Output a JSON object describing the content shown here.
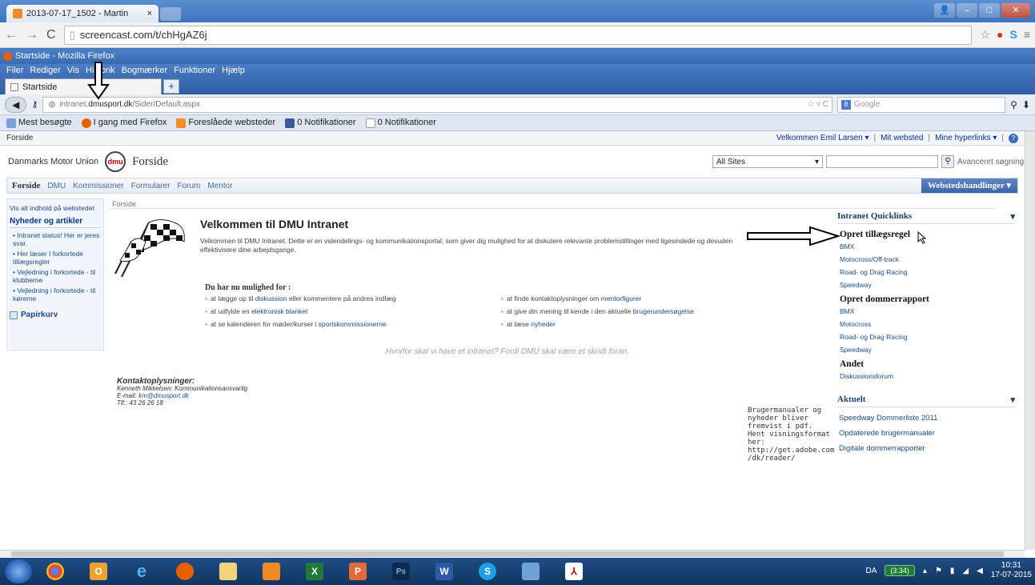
{
  "chrome": {
    "tab_title": "2013-07-17_1502 - Martin",
    "tab_close": "×",
    "url": "screencast.com/t/chHgAZ6j"
  },
  "firefox": {
    "window_title": "Startside - Mozilla Firefox",
    "menu": [
      "Filer",
      "Rediger",
      "Vis",
      "Historik",
      "Bogmærker",
      "Funktioner",
      "Hjælp"
    ],
    "tab_label": "Startside",
    "new_tab": "+",
    "url_prefix": "intranet.",
    "url_domain": "dmusport.dk",
    "url_path": "/Sider/Default.aspx",
    "search_placeholder": "Google",
    "bookmarks": [
      "Mest besøgte",
      "I gang med Firefox",
      "Foreslåede websteder",
      "0 Notifikationer",
      "0 Notifikationer"
    ]
  },
  "sp": {
    "top_left": "Forside",
    "welcome_items": [
      "Velkommen Emil Larsen ▾",
      "|",
      "Mit websted",
      "|",
      "Mine hyperlinks ▾",
      "|"
    ],
    "org_name": "Danmarks Motor Union",
    "logo_text": "dmu",
    "site_title": "Forside",
    "search_scope": "All Sites",
    "advanced_search": "Avanceret søgning",
    "nav": [
      "Forside",
      "DMU",
      "Kommissioner",
      "Formularer",
      "Forum",
      "Mentor"
    ],
    "site_actions": "Webstedshandlinger ▾",
    "left": {
      "view_all": "Vis alt indhold på webstedet",
      "news_header": "Nyheder og artikler",
      "news": [
        "• Intranet status! Her er jeres svar.",
        "• Her læser I forkortede tillægsregler",
        "• Vejledning i forkortede - til klubberne",
        "• Vejledning i forkortede - til kørerne"
      ],
      "recycle": "Papirkurv"
    },
    "breadcrumb": "Forside",
    "welcome_title": "Velkommen til DMU Intranet",
    "intro": "Velkommen til DMU Intranet. Dette er en videndelings- og kommunikationsportal, som giver dig mulighed for at diskutere relevante problemstillinger med ligesindede og desuden effektivisere dine arbejdsgange.",
    "opp_title": "Du har nu mulighed for :",
    "opps": [
      {
        "pre": "at lægge op til ",
        "link": "diskussion",
        "post": " eller kommentere på andres indlæg"
      },
      {
        "pre": "at finde kontaktoplysninger om ",
        "link": "mentorfigurer",
        "post": ""
      },
      {
        "pre": "at udfylde en ",
        "link": "elektronisk blanket",
        "post": ""
      },
      {
        "pre": "at give din mening til kende i den aktuelle ",
        "link": "brugerundersøgelse",
        "post": ""
      },
      {
        "pre": "at se kalenderen for møder/kurser i ",
        "link": "sportskommissionerne",
        "post": ""
      },
      {
        "pre": "at læse ",
        "link": "nyheder",
        "post": ""
      }
    ],
    "tagline": "Hvorfor skal vi have et intranet? Fordi DMU skal være et skridt foran.",
    "contact": {
      "title": "Kontaktoplysninger:",
      "line1": "Kenneth Mikkelsen: Kommunikationsansvarlig",
      "email_label": "E-mail: ",
      "email": "km@dmusport.dk",
      "phone": "Tlf.: 43 26 26 18"
    },
    "pdf_note": "Brugermanualer og nyheder bliver fremvist i pdf. Hent visningsformat her: http://get.adobe.com /dk/reader/",
    "quicklinks": {
      "title": "Intranet Quicklinks",
      "sec1": "Opret tillægsregel",
      "sec1_links": [
        "BMX",
        "Motocross/Off-track",
        "Road- og Drag Racing",
        "Speedway"
      ],
      "sec2": "Opret dommerrapport",
      "sec2_links": [
        "BMX",
        "Motocross",
        "Road- og Drag Racing",
        "Speedway"
      ],
      "sec3": "Andet",
      "sec3_links": [
        "Diskussionsforum"
      ]
    },
    "aktuelt": {
      "title": "Aktuelt",
      "links": [
        "Speedway Dommerliste 2011",
        "Opdaterede brugermanualer",
        "Digitale dommerrapporter"
      ]
    }
  },
  "taskbar": {
    "apps": [
      "start",
      "chrome",
      "outlook",
      "ie",
      "firefox",
      "explorer",
      "screencast",
      "excel",
      "publisher",
      "photoshop",
      "word",
      "skype",
      "notes",
      "acrobat"
    ],
    "lang": "DA",
    "battery": "(3:34)",
    "time": "10:31",
    "date": "17-07-2015"
  }
}
